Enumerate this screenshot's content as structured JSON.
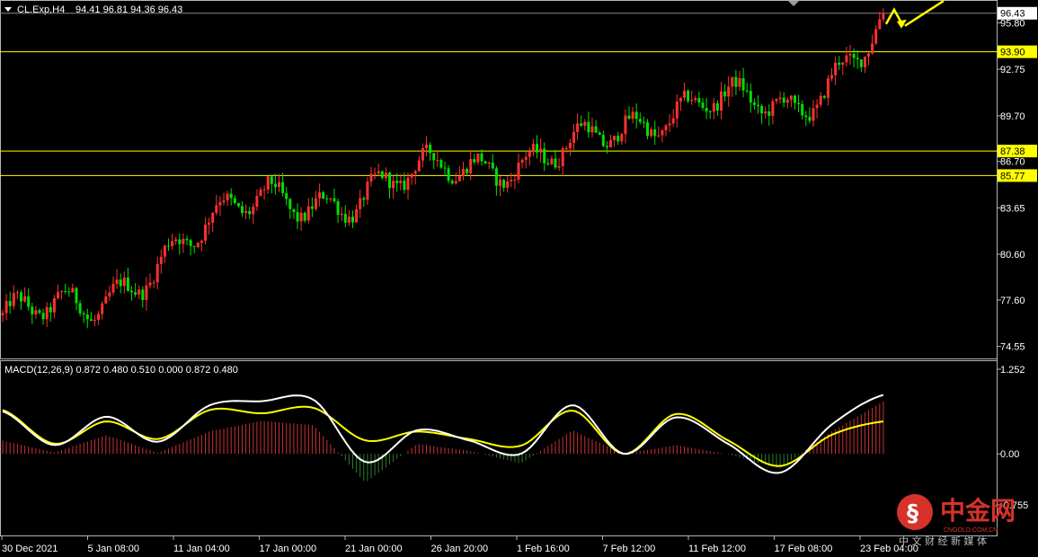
{
  "header": {
    "symbol": "CL.Exp,H4",
    "ohlc": "94.41 96.81 94.36 96.43"
  },
  "macd_header": "MACD(12,26,9) 0.872 0.480 0.510 0.000 0.872 0.480",
  "price_axis": {
    "ticks": [
      "95.80",
      "92.75",
      "89.70",
      "86.70",
      "83.65",
      "80.60",
      "77.60",
      "74.55"
    ],
    "current": "96.43"
  },
  "levels": [
    {
      "label": "93.90",
      "value": 93.9
    },
    {
      "label": "87.38",
      "value": 87.38
    },
    {
      "label": "85.77",
      "value": 85.77
    }
  ],
  "macd_axis": {
    "ticks": [
      "1.252",
      "0.00",
      "-0.755"
    ]
  },
  "time_axis": [
    "30 Dec 2021",
    "5 Jan 08:00",
    "11 Jan 04:00",
    "17 Jan 00:00",
    "21 Jan 00:00",
    "26 Jan 20:00",
    "1 Feb 16:00",
    "7 Feb 12:00",
    "11 Feb 12:00",
    "17 Feb 08:00",
    "23 Feb 04:00"
  ],
  "watermark": {
    "cn": "中金网",
    "en": "CNGOLD.COM.CN",
    "tagline": "中 文 财 经 新 媒 体"
  },
  "colors": {
    "up": "#ff3030",
    "down": "#00e000",
    "level": "#ffff00",
    "macd_main": "#ffffff",
    "macd_signal": "#ffff00",
    "hist_pos": "#c83232",
    "hist_neg": "#2f7d2f",
    "grid": "#b4b4b4"
  },
  "chart_data": {
    "type": "candlestick",
    "symbol": "CL.Exp",
    "timeframe": "H4",
    "ylim": [
      73.7,
      97.3
    ],
    "key_closes": [
      [
        "30 Dec 2021",
        76.6
      ],
      [
        "5 Jan 08:00",
        77.0
      ],
      [
        "11 Jan 04:00",
        81.3
      ],
      [
        "17 Jan 00:00",
        84.5
      ],
      [
        "21 Jan 00:00",
        84.0
      ],
      [
        "26 Jan 20:00",
        86.6
      ],
      [
        "1 Feb 16:00",
        86.6
      ],
      [
        "7 Feb 12:00",
        88.5
      ],
      [
        "11 Feb 12:00",
        91.2
      ],
      [
        "17 Feb 08:00",
        89.5
      ],
      [
        "23 Feb 04:00",
        96.43
      ]
    ],
    "macd": {
      "params": "12,26,9",
      "ylim": [
        -0.755,
        1.252
      ],
      "main_key": [
        0.63,
        0.13,
        0.55,
        0.18,
        0.72,
        0.78,
        0.8,
        -0.12,
        0.35,
        0.2,
        0.0,
        0.72,
        0.0,
        0.54,
        0.15,
        -0.28,
        0.43,
        0.872
      ],
      "signal_key": [
        0.65,
        0.15,
        0.48,
        0.22,
        0.65,
        0.6,
        0.68,
        0.2,
        0.33,
        0.22,
        0.12,
        0.64,
        0.0,
        0.59,
        0.2,
        -0.18,
        0.28,
        0.48
      ]
    }
  }
}
